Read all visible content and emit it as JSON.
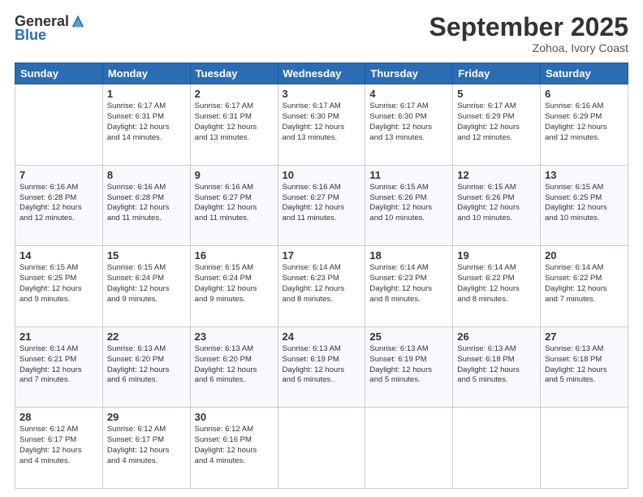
{
  "logo": {
    "general": "General",
    "blue": "Blue"
  },
  "title": "September 2025",
  "location": "Zohoa, Ivory Coast",
  "days_of_week": [
    "Sunday",
    "Monday",
    "Tuesday",
    "Wednesday",
    "Thursday",
    "Friday",
    "Saturday"
  ],
  "weeks": [
    [
      {
        "num": "",
        "sunrise": "",
        "sunset": "",
        "daylight": "",
        "empty": true
      },
      {
        "num": "1",
        "sunrise": "Sunrise: 6:17 AM",
        "sunset": "Sunset: 6:31 PM",
        "daylight": "Daylight: 12 hours and 14 minutes."
      },
      {
        "num": "2",
        "sunrise": "Sunrise: 6:17 AM",
        "sunset": "Sunset: 6:31 PM",
        "daylight": "Daylight: 12 hours and 13 minutes."
      },
      {
        "num": "3",
        "sunrise": "Sunrise: 6:17 AM",
        "sunset": "Sunset: 6:30 PM",
        "daylight": "Daylight: 12 hours and 13 minutes."
      },
      {
        "num": "4",
        "sunrise": "Sunrise: 6:17 AM",
        "sunset": "Sunset: 6:30 PM",
        "daylight": "Daylight: 12 hours and 13 minutes."
      },
      {
        "num": "5",
        "sunrise": "Sunrise: 6:17 AM",
        "sunset": "Sunset: 6:29 PM",
        "daylight": "Daylight: 12 hours and 12 minutes."
      },
      {
        "num": "6",
        "sunrise": "Sunrise: 6:16 AM",
        "sunset": "Sunset: 6:29 PM",
        "daylight": "Daylight: 12 hours and 12 minutes."
      }
    ],
    [
      {
        "num": "7",
        "sunrise": "Sunrise: 6:16 AM",
        "sunset": "Sunset: 6:28 PM",
        "daylight": "Daylight: 12 hours and 12 minutes."
      },
      {
        "num": "8",
        "sunrise": "Sunrise: 6:16 AM",
        "sunset": "Sunset: 6:28 PM",
        "daylight": "Daylight: 12 hours and 11 minutes."
      },
      {
        "num": "9",
        "sunrise": "Sunrise: 6:16 AM",
        "sunset": "Sunset: 6:27 PM",
        "daylight": "Daylight: 12 hours and 11 minutes."
      },
      {
        "num": "10",
        "sunrise": "Sunrise: 6:16 AM",
        "sunset": "Sunset: 6:27 PM",
        "daylight": "Daylight: 12 hours and 11 minutes."
      },
      {
        "num": "11",
        "sunrise": "Sunrise: 6:15 AM",
        "sunset": "Sunset: 6:26 PM",
        "daylight": "Daylight: 12 hours and 10 minutes."
      },
      {
        "num": "12",
        "sunrise": "Sunrise: 6:15 AM",
        "sunset": "Sunset: 6:26 PM",
        "daylight": "Daylight: 12 hours and 10 minutes."
      },
      {
        "num": "13",
        "sunrise": "Sunrise: 6:15 AM",
        "sunset": "Sunset: 6:25 PM",
        "daylight": "Daylight: 12 hours and 10 minutes."
      }
    ],
    [
      {
        "num": "14",
        "sunrise": "Sunrise: 6:15 AM",
        "sunset": "Sunset: 6:25 PM",
        "daylight": "Daylight: 12 hours and 9 minutes."
      },
      {
        "num": "15",
        "sunrise": "Sunrise: 6:15 AM",
        "sunset": "Sunset: 6:24 PM",
        "daylight": "Daylight: 12 hours and 9 minutes."
      },
      {
        "num": "16",
        "sunrise": "Sunrise: 6:15 AM",
        "sunset": "Sunset: 6:24 PM",
        "daylight": "Daylight: 12 hours and 9 minutes."
      },
      {
        "num": "17",
        "sunrise": "Sunrise: 6:14 AM",
        "sunset": "Sunset: 6:23 PM",
        "daylight": "Daylight: 12 hours and 8 minutes."
      },
      {
        "num": "18",
        "sunrise": "Sunrise: 6:14 AM",
        "sunset": "Sunset: 6:23 PM",
        "daylight": "Daylight: 12 hours and 8 minutes."
      },
      {
        "num": "19",
        "sunrise": "Sunrise: 6:14 AM",
        "sunset": "Sunset: 6:22 PM",
        "daylight": "Daylight: 12 hours and 8 minutes."
      },
      {
        "num": "20",
        "sunrise": "Sunrise: 6:14 AM",
        "sunset": "Sunset: 6:22 PM",
        "daylight": "Daylight: 12 hours and 7 minutes."
      }
    ],
    [
      {
        "num": "21",
        "sunrise": "Sunrise: 6:14 AM",
        "sunset": "Sunset: 6:21 PM",
        "daylight": "Daylight: 12 hours and 7 minutes."
      },
      {
        "num": "22",
        "sunrise": "Sunrise: 6:13 AM",
        "sunset": "Sunset: 6:20 PM",
        "daylight": "Daylight: 12 hours and 6 minutes."
      },
      {
        "num": "23",
        "sunrise": "Sunrise: 6:13 AM",
        "sunset": "Sunset: 6:20 PM",
        "daylight": "Daylight: 12 hours and 6 minutes."
      },
      {
        "num": "24",
        "sunrise": "Sunrise: 6:13 AM",
        "sunset": "Sunset: 6:19 PM",
        "daylight": "Daylight: 12 hours and 6 minutes."
      },
      {
        "num": "25",
        "sunrise": "Sunrise: 6:13 AM",
        "sunset": "Sunset: 6:19 PM",
        "daylight": "Daylight: 12 hours and 5 minutes."
      },
      {
        "num": "26",
        "sunrise": "Sunrise: 6:13 AM",
        "sunset": "Sunset: 6:18 PM",
        "daylight": "Daylight: 12 hours and 5 minutes."
      },
      {
        "num": "27",
        "sunrise": "Sunrise: 6:13 AM",
        "sunset": "Sunset: 6:18 PM",
        "daylight": "Daylight: 12 hours and 5 minutes."
      }
    ],
    [
      {
        "num": "28",
        "sunrise": "Sunrise: 6:12 AM",
        "sunset": "Sunset: 6:17 PM",
        "daylight": "Daylight: 12 hours and 4 minutes."
      },
      {
        "num": "29",
        "sunrise": "Sunrise: 6:12 AM",
        "sunset": "Sunset: 6:17 PM",
        "daylight": "Daylight: 12 hours and 4 minutes."
      },
      {
        "num": "30",
        "sunrise": "Sunrise: 6:12 AM",
        "sunset": "Sunset: 6:16 PM",
        "daylight": "Daylight: 12 hours and 4 minutes."
      },
      {
        "num": "",
        "empty": true
      },
      {
        "num": "",
        "empty": true
      },
      {
        "num": "",
        "empty": true
      },
      {
        "num": "",
        "empty": true
      }
    ]
  ]
}
